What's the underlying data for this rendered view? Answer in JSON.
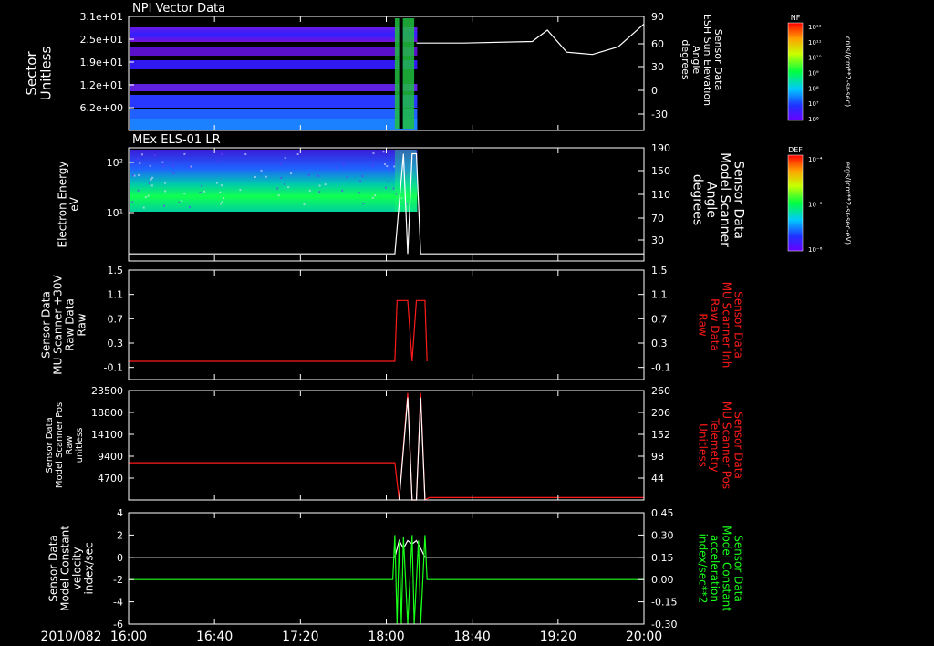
{
  "date_label": "2010/082",
  "time_ticks": [
    "16:00",
    "16:40",
    "17:20",
    "18:00",
    "18:40",
    "19:20",
    "20:00"
  ],
  "colors": {
    "background": "#000000",
    "frame": "#ffffff",
    "trace_white": "#ffffff",
    "trace_red": "#ff1a1a",
    "trace_green": "#19ff19"
  },
  "colorbars": [
    {
      "label": "NF",
      "units": "cnts/(cm**2-sr-sec)",
      "ticks": [
        "10¹²",
        "10¹¹",
        "10¹⁰",
        "10⁹",
        "10⁸",
        "10⁷",
        "10⁶"
      ]
    },
    {
      "label": "DEF",
      "units": "ergs/(cm**2-sr-sec-eV)",
      "ticks": [
        "10⁻⁴",
        "10⁻⁵",
        "10⁻⁶"
      ]
    }
  ],
  "chart_data": [
    {
      "type": "heatmap",
      "title": "NPI Vector Data",
      "ylabel_lines": [
        "Sector",
        "Unitless"
      ],
      "ytick_labels": [
        "3.1e+01",
        "2.5e+01",
        "1.9e+01",
        "1.2e+01",
        "6.2e+00"
      ],
      "right_axis": {
        "label_lines": [
          "Sensor Data",
          "ESH Sun Elevation",
          "Angle",
          "degrees"
        ],
        "ticks": [
          "90",
          "60",
          "30",
          "0",
          "-30"
        ],
        "label_color": "#ffffff"
      },
      "series": [
        {
          "color": "#ffffff",
          "x": [
            "18:14",
            "18:36",
            "19:08",
            "19:15",
            "19:24",
            "19:36",
            "19:48",
            "20:00"
          ],
          "y": [
            55,
            55,
            57,
            72,
            43,
            40,
            50,
            80
          ]
        }
      ],
      "notes": "Spectrogram filled with counts from 16:00 to about 18:14, no data afterwards"
    },
    {
      "type": "heatmap",
      "title": "MEx ELS-01 LR",
      "ylabel_lines": [
        "Electron Energy",
        "eV"
      ],
      "ytick_labels": [
        "10²",
        "10¹"
      ],
      "right_axis": {
        "label_lines": [
          "Sensor Data",
          "Model Scanner",
          "Angle",
          "degrees"
        ],
        "ticks": [
          "190",
          "150",
          "110",
          "70",
          "30"
        ],
        "label_color": "#ffffff"
      },
      "series": [
        {
          "color": "#ffffff",
          "x": [
            "16:00",
            "18:04",
            "18:08",
            "18:10",
            "18:12",
            "18:14",
            "18:16",
            "18:20",
            "18:24",
            "20:00"
          ],
          "y": [
            12,
            12,
            180,
            12,
            180,
            180,
            12,
            12,
            12,
            12
          ]
        }
      ],
      "notes": "Electron energy spectrogram from 16:00 to about 18:14"
    },
    {
      "type": "line",
      "yticks": [
        "1.5",
        "1.1",
        "0.7",
        "0.3",
        "-0.1"
      ],
      "ylim": [
        -0.3,
        1.5
      ],
      "ylabel_lines": [
        "Sensor Data",
        "MU Scanner +30V",
        "Raw Data",
        "Raw"
      ],
      "right_axis": {
        "label_lines": [
          "Sensor Data",
          "MU Scanner Inh",
          "Raw Data",
          "Raw"
        ],
        "ticks": [
          "1.5",
          "1.1",
          "0.7",
          "0.3",
          "-0.1"
        ],
        "label_color": "#ff1a1a"
      },
      "series": [
        {
          "color": "#ff1a1a",
          "x": [
            "16:00",
            "18:04",
            "18:05",
            "18:10",
            "18:12",
            "18:14",
            "18:16",
            "18:18",
            "18:19"
          ],
          "y": [
            0,
            0,
            1,
            1,
            0,
            1,
            1,
            1,
            0
          ]
        }
      ]
    },
    {
      "type": "line",
      "yticks": [
        "23500",
        "18800",
        "14100",
        "9400",
        "4700"
      ],
      "ylim": [
        0,
        23500
      ],
      "ylabel_lines": [
        "Sensor Data",
        "Model Scanner Pos",
        "Raw",
        "unitless"
      ],
      "right_axis": {
        "label_lines": [
          "Sensor Data",
          "MU Scanner Pos",
          "Telemetry",
          "Unitless"
        ],
        "ticks": [
          "260",
          "206",
          "152",
          "98",
          "44"
        ],
        "label_color": "#ff1a1a"
      },
      "series": [
        {
          "color": "#ff1a1a",
          "x": [
            "16:00",
            "18:04",
            "18:06",
            "18:10",
            "18:12",
            "18:14",
            "18:16",
            "18:18",
            "18:20",
            "20:00"
          ],
          "y": [
            8000,
            8000,
            0,
            23000,
            0,
            0,
            23000,
            0,
            500,
            500
          ]
        },
        {
          "color": "#ffffff",
          "x": [
            "18:06",
            "18:10",
            "18:12",
            "18:14",
            "18:16",
            "18:18"
          ],
          "y": [
            0,
            22000,
            0,
            0,
            22000,
            0
          ]
        }
      ]
    },
    {
      "type": "line",
      "yticks": [
        "4",
        "2",
        "0",
        "-2",
        "-4",
        "-6"
      ],
      "ylim": [
        -6,
        4
      ],
      "ylabel_lines": [
        "Sensor Data",
        "Model Constant",
        "velocity",
        "index/sec"
      ],
      "right_axis": {
        "label_lines": [
          "Sensor Data",
          "Model Constant",
          "acceleration",
          "index/sec**2"
        ],
        "ticks": [
          "0.45",
          "0.30",
          "0.15",
          "0.00",
          "-0.15",
          "-0.30"
        ],
        "label_color": "#19ff19"
      },
      "series": [
        {
          "color": "#ffffff",
          "x": [
            "16:00",
            "18:04",
            "18:06",
            "18:08",
            "18:10",
            "18:12",
            "18:14",
            "18:16",
            "18:18",
            "20:00"
          ],
          "y": [
            0,
            0,
            1.5,
            0.8,
            1.5,
            1.2,
            1.5,
            0.8,
            0,
            0
          ]
        },
        {
          "color": "#19ff19",
          "x": [
            "16:00",
            "18:03",
            "18:04",
            "18:05",
            "18:06",
            "18:07",
            "18:08",
            "18:10",
            "18:12",
            "18:13",
            "18:15",
            "18:16",
            "18:18",
            "18:19",
            "20:00"
          ],
          "y": [
            -2,
            -2,
            2,
            -6,
            1.5,
            -6,
            1.8,
            -6,
            2,
            -6,
            1.5,
            -6,
            2,
            -2,
            -2
          ]
        }
      ]
    }
  ]
}
